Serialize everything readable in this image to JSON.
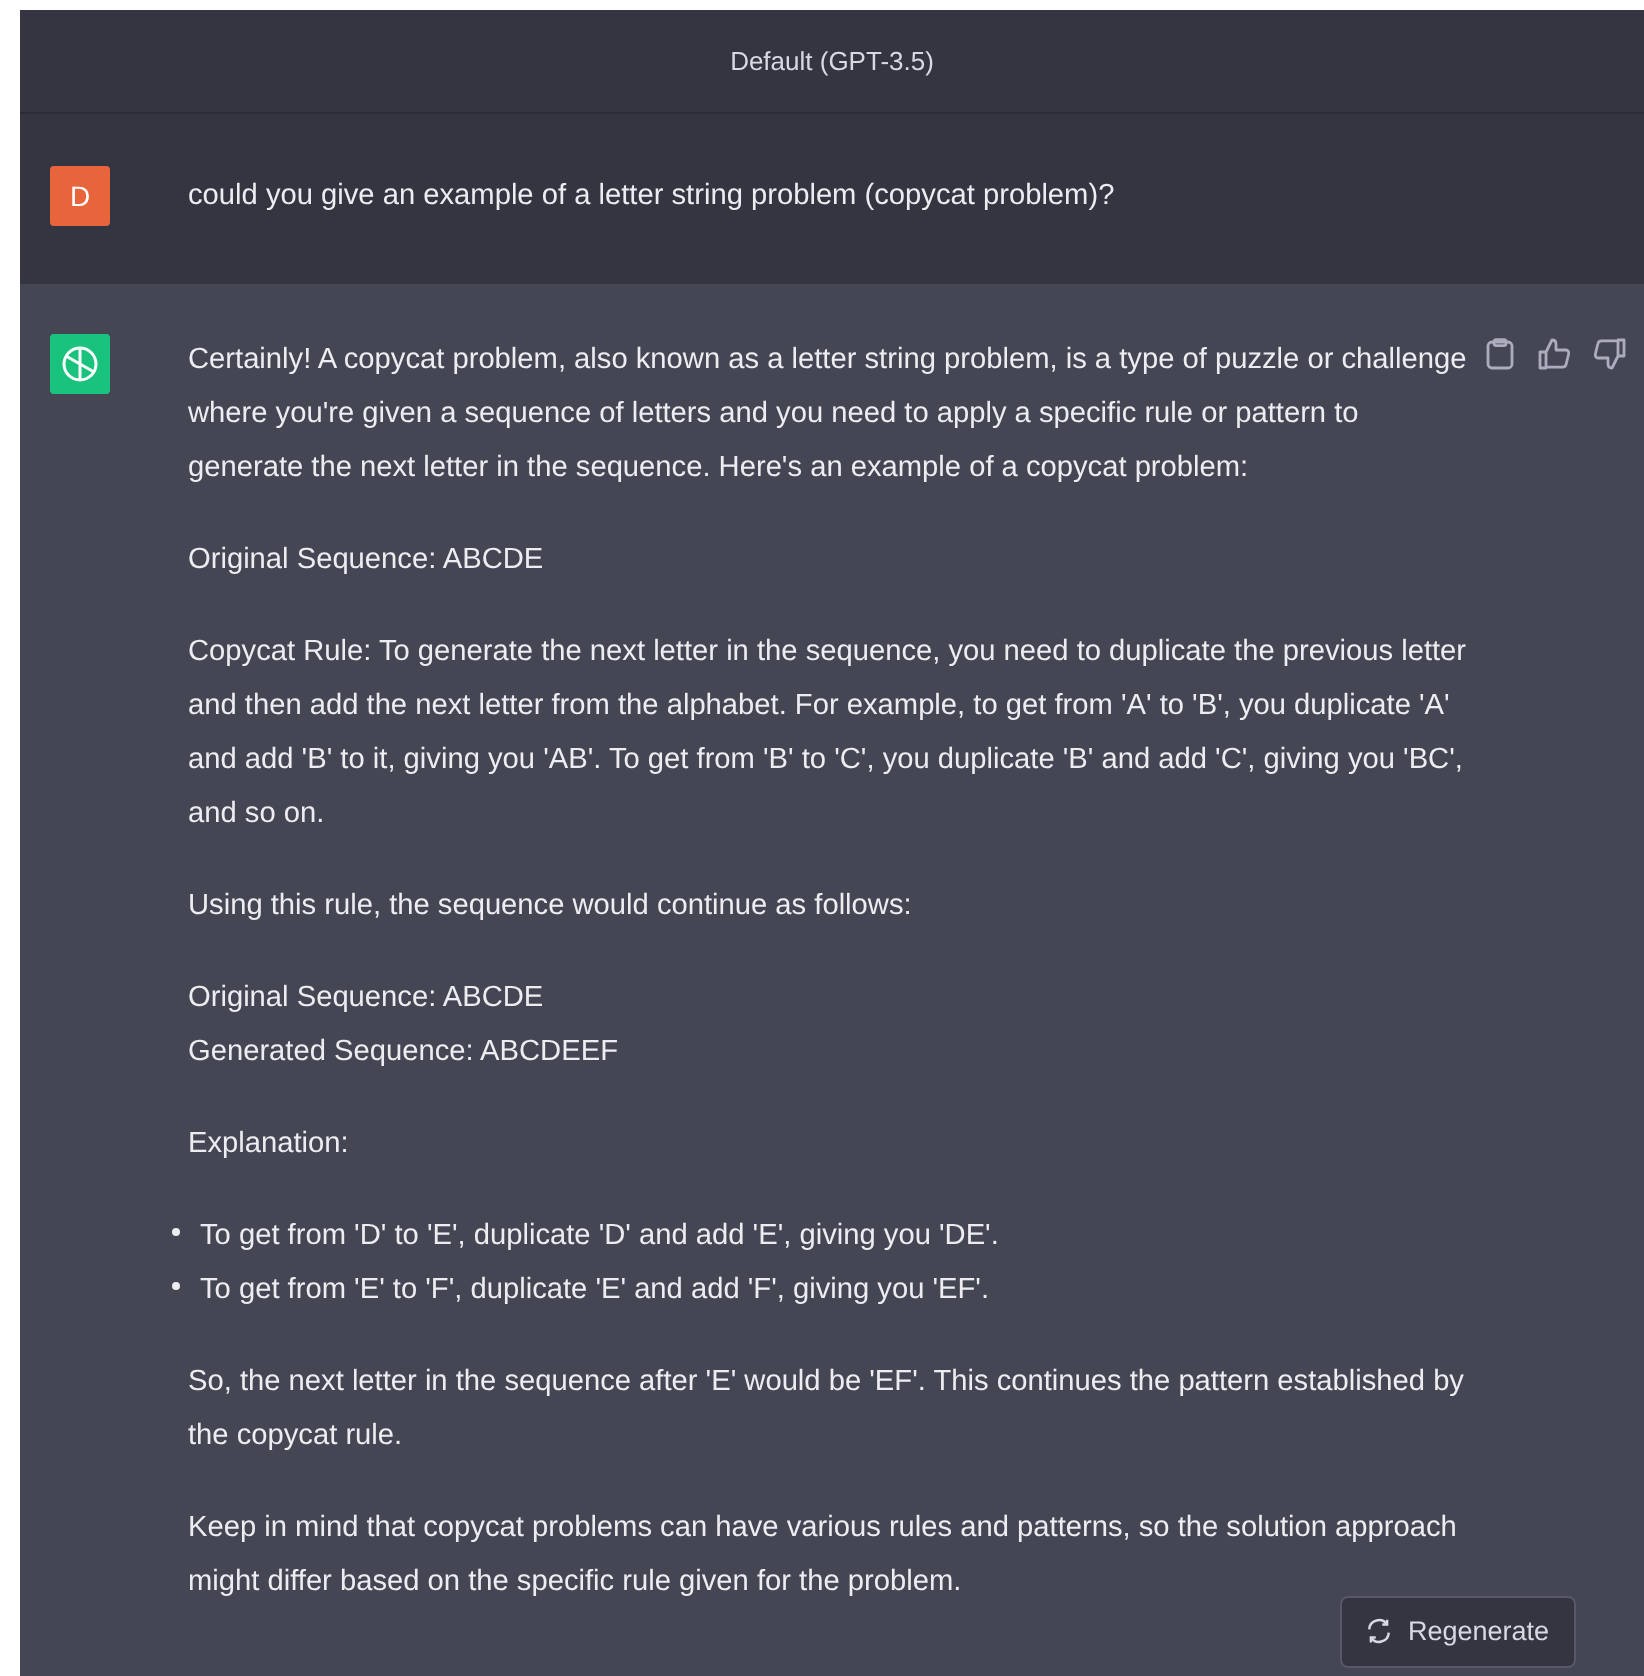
{
  "header": {
    "title": "Default (GPT-3.5)"
  },
  "user_message": {
    "avatar": "D",
    "text": "could you give an example of a letter string problem (copycat problem)?"
  },
  "assistant_message": {
    "blocks": [
      {
        "kind": "paragraph",
        "lines": [
          "Certainly! A copycat problem, also known as a letter string problem, is a type of puzzle or challenge where you're given a sequence of letters and you need to apply a specific rule or pattern to generate the next letter in the sequence. Here's an example of a copycat problem:"
        ]
      },
      {
        "kind": "paragraph",
        "lines": [
          "Original Sequence: ABCDE"
        ]
      },
      {
        "kind": "paragraph",
        "lines": [
          "Copycat Rule: To generate the next letter in the sequence, you need to duplicate the previous letter and then add the next letter from the alphabet. For example, to get from 'A' to 'B', you duplicate 'A' and add 'B' to it, giving you 'AB'. To get from 'B' to 'C', you duplicate 'B' and add 'C', giving you 'BC', and so on."
        ]
      },
      {
        "kind": "paragraph",
        "lines": [
          "Using this rule, the sequence would continue as follows:"
        ]
      },
      {
        "kind": "paragraph",
        "lines": [
          "Original Sequence: ABCDE",
          "Generated Sequence: ABCDEEF"
        ]
      },
      {
        "kind": "paragraph",
        "lines": [
          "Explanation:"
        ]
      },
      {
        "kind": "bullets",
        "lines": [
          "To get from 'D' to 'E', duplicate 'D' and add 'E', giving you 'DE'.",
          "To get from 'E' to 'F', duplicate 'E' and add 'F', giving you 'EF'."
        ]
      },
      {
        "kind": "paragraph",
        "lines": [
          "So, the next letter in the sequence after 'E' would be 'EF'. This continues the pattern established by the copycat rule."
        ]
      },
      {
        "kind": "paragraph",
        "lines": [
          "Keep in mind that copycat problems can have various rules and patterns, so the solution approach might differ based on the specific rule given for the problem."
        ]
      }
    ]
  },
  "regenerate_button": {
    "label": "Regenerate"
  }
}
